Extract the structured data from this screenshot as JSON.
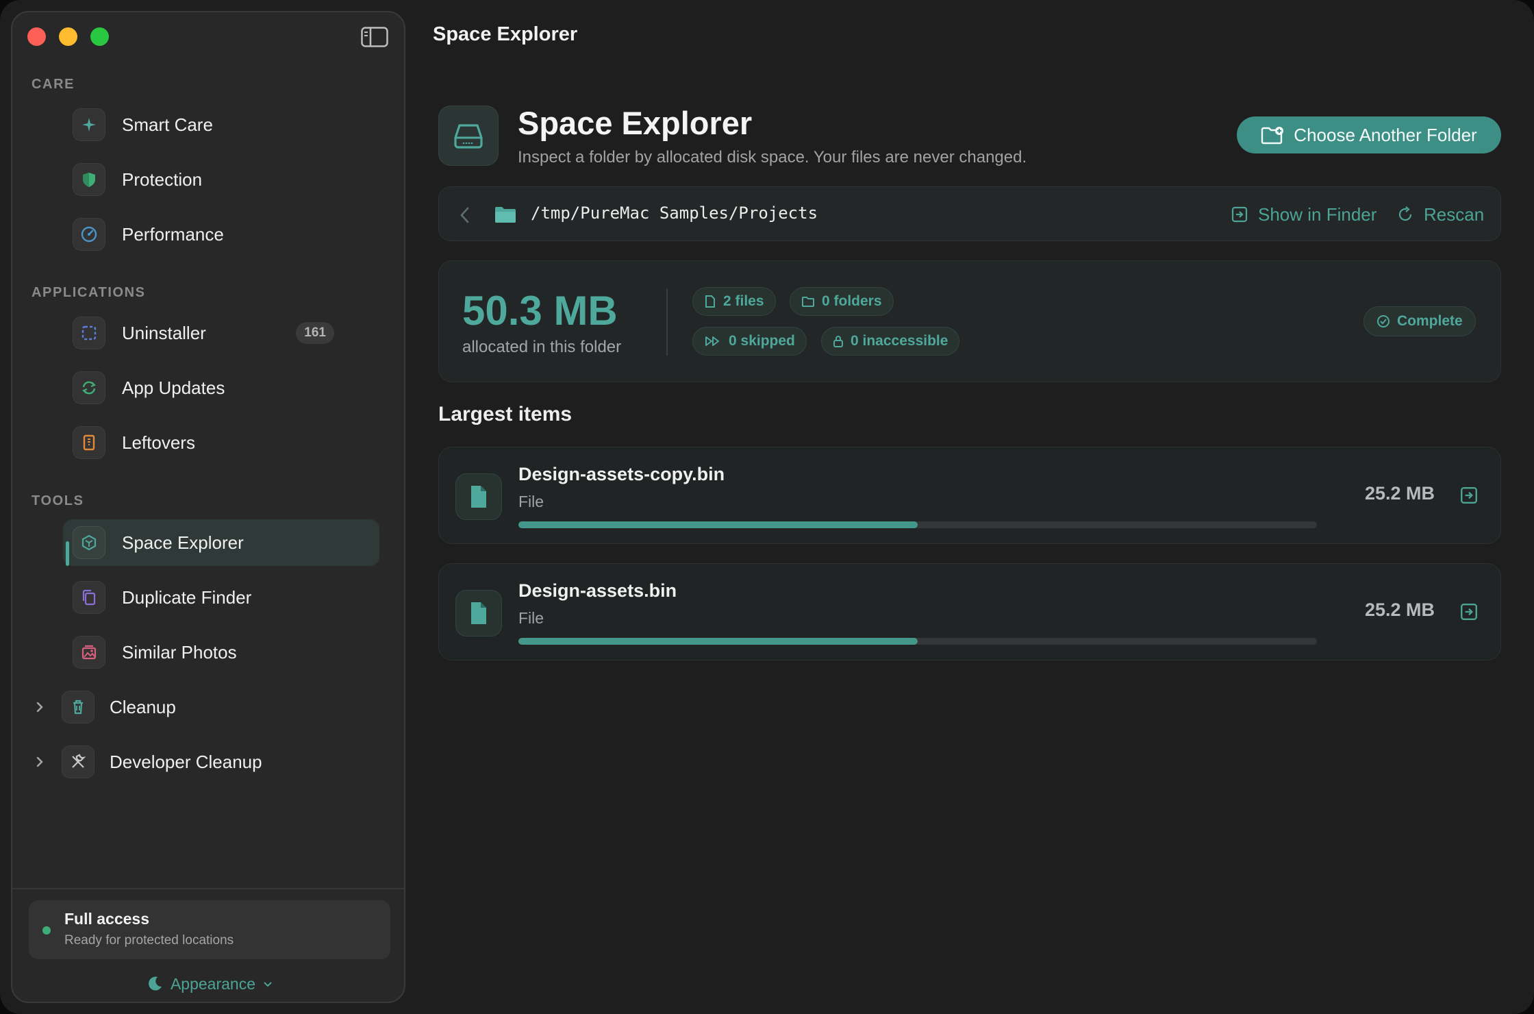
{
  "window": {
    "title": "Space Explorer"
  },
  "sidebar": {
    "sections": {
      "care": "CARE",
      "applications": "APPLICATIONS",
      "tools": "TOOLS"
    },
    "care_items": [
      {
        "label": "Smart Care",
        "icon": "sparkle-icon"
      },
      {
        "label": "Protection",
        "icon": "shield-icon"
      },
      {
        "label": "Performance",
        "icon": "gauge-icon"
      }
    ],
    "app_items": [
      {
        "label": "Uninstaller",
        "icon": "dashed-square-icon",
        "badge": "161"
      },
      {
        "label": "App Updates",
        "icon": "refresh-icon"
      },
      {
        "label": "Leftovers",
        "icon": "archive-icon"
      }
    ],
    "tool_items": [
      {
        "label": "Space Explorer",
        "icon": "cube-icon",
        "active": true
      },
      {
        "label": "Duplicate Finder",
        "icon": "duplicate-icon"
      },
      {
        "label": "Similar Photos",
        "icon": "photos-icon"
      }
    ],
    "groups": [
      {
        "label": "Cleanup",
        "icon": "trash-icon"
      },
      {
        "label": "Developer Cleanup",
        "icon": "tools-icon"
      }
    ],
    "access": {
      "title": "Full access",
      "subtitle": "Ready for protected locations"
    },
    "appearance": "Appearance"
  },
  "header": {
    "title": "Space Explorer",
    "subtitle": "Inspect a folder by allocated disk space. Your files are never changed.",
    "choose_button": "Choose Another Folder"
  },
  "pathbar": {
    "path": "/tmp/PureMac Samples/Projects",
    "show_in_finder": "Show in Finder",
    "rescan": "Rescan"
  },
  "summary": {
    "size": "50.3 MB",
    "size_caption": "allocated in this folder",
    "files": "2 files",
    "folders": "0 folders",
    "skipped": "0 skipped",
    "inaccessible": "0 inaccessible",
    "status": "Complete"
  },
  "largest": {
    "heading": "Largest items",
    "items": [
      {
        "name": "Design-assets-copy.bin",
        "kind": "File",
        "size": "25.2 MB",
        "fraction": 0.5
      },
      {
        "name": "Design-assets.bin",
        "kind": "File",
        "size": "25.2 MB",
        "fraction": 0.5
      }
    ]
  },
  "colors": {
    "accent": "#4ea89b",
    "background": "#1e1e1e",
    "sidebar": "#282828"
  }
}
